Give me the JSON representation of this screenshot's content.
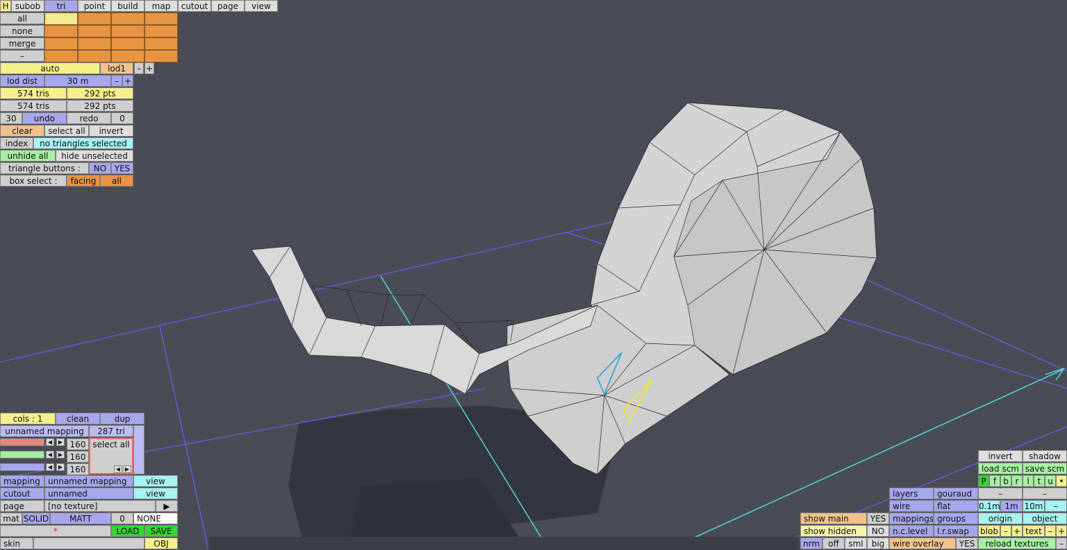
{
  "menu": {
    "h": "H",
    "tabs": [
      "subob",
      "tri",
      "point",
      "build",
      "map",
      "cutout",
      "page",
      "view"
    ]
  },
  "select_rows": [
    "all",
    "none",
    "merge",
    "–"
  ],
  "lod": {
    "auto": "auto",
    "lod1": "lod1",
    "minus": "–",
    "plus": "+"
  },
  "lod_dist": {
    "label": "lod dist",
    "value": "30 m",
    "minus": "–",
    "plus": "+"
  },
  "stats": {
    "tris_a": "574 tris",
    "pts_a": "292 pts",
    "tris_b": "574 tris",
    "pts_b": "292 pts"
  },
  "undo": {
    "count": "30",
    "undo": "undo",
    "redo": "redo",
    "redo_count": "0"
  },
  "selection": {
    "clear": "clear",
    "select_all": "select all",
    "invert": "invert"
  },
  "index": {
    "label": "index",
    "status": "no triangles selected"
  },
  "hide": {
    "unhide_all": "unhide all",
    "hide_unselected": "hide unselected"
  },
  "triangle_buttons": {
    "label": "triangle buttons :",
    "no": "NO",
    "yes": "YES"
  },
  "box_select": {
    "label": "box select :",
    "facing": "facing",
    "all": "all"
  },
  "cols": {
    "label": "cols : 1",
    "clean": "clean",
    "dup": "dup"
  },
  "mapping_header": {
    "name": "unnamed mapping",
    "tris": "287 tri"
  },
  "sliders": [
    "160",
    "160",
    "160"
  ],
  "select_all_box": "select all",
  "colors": {
    "red": "#e8857a",
    "green": "#a3ee9c",
    "blue": "#a6a6ef",
    "accent_orange": "#e89440",
    "viewport": "#4a4c55"
  },
  "props": {
    "mapping_label": "mapping",
    "mapping_value": "unnamed mapping",
    "mapping_view": "view",
    "cutout_label": "cutout",
    "cutout_value": "unnamed",
    "cutout_view": "view",
    "page_label": "page",
    "page_value": "[no texture]",
    "page_arrow": "▶",
    "mat": "mat",
    "solid": "SOLID",
    "matt": "MATT",
    "zero": "0",
    "none": "NONE",
    "star": "*",
    "load": "LOAD",
    "save": "SAVE",
    "skin": "skin",
    "obj": "OBJ"
  },
  "right_panel": {
    "invert": "invert",
    "shadow": "shadow",
    "load_scm": "load scm",
    "save_scm": "save scm",
    "letters": [
      "P",
      "f",
      "b",
      "r",
      "l",
      "t",
      "u",
      "•"
    ],
    "minus": "–",
    "grid_01": "0.1m",
    "grid_1": "1m",
    "grid_10": "10m",
    "origin": "origin",
    "object": "object",
    "blob": "blob",
    "text": "text",
    "plus": "+",
    "reload": "reload textures"
  },
  "display": {
    "layers": "layers",
    "gouraud": "gouraud",
    "wire": "wire",
    "flat": "flat",
    "mappings": "mappings",
    "groups": "groups",
    "nclevel": "n.c.level",
    "lrswap": "l.r.swap",
    "wire_overlay": "wire overlay",
    "wire_overlay_val": "YES"
  },
  "show": {
    "main": "show main",
    "main_val": "YES",
    "hidden": "show hidden",
    "hidden_val": "NO",
    "nrm": "nrm",
    "off": "off",
    "sml": "sml",
    "big": "big"
  }
}
